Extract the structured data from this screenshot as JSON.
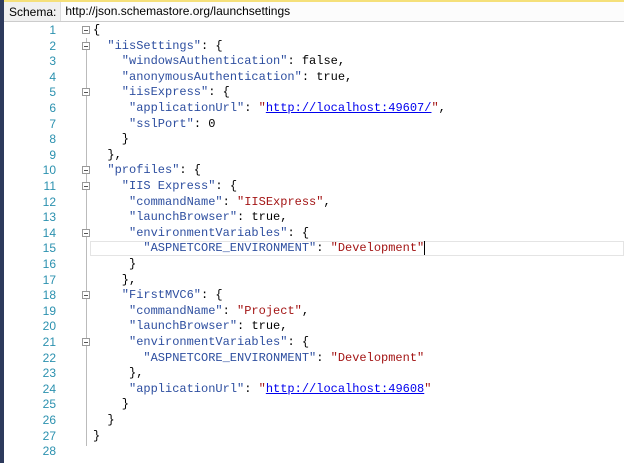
{
  "schema": {
    "label": "Schema:",
    "url": "http://json.schemastore.org/launchsettings"
  },
  "current_line": 15,
  "lines": [
    {
      "n": "1",
      "fold": true,
      "ind": 0,
      "tok": [
        [
          "p",
          "{"
        ]
      ]
    },
    {
      "n": "2",
      "fold": true,
      "ind": 1,
      "tok": [
        [
          "k",
          "\"iisSettings\""
        ],
        [
          "p",
          ": {"
        ]
      ]
    },
    {
      "n": "3",
      "ind": 2,
      "tok": [
        [
          "k",
          "\"windowsAuthentication\""
        ],
        [
          "p",
          ": "
        ],
        [
          "b",
          "false"
        ],
        [
          "p",
          ","
        ]
      ]
    },
    {
      "n": "4",
      "ind": 2,
      "tok": [
        [
          "k",
          "\"anonymousAuthentication\""
        ],
        [
          "p",
          ": "
        ],
        [
          "b",
          "true"
        ],
        [
          "p",
          ","
        ]
      ]
    },
    {
      "n": "5",
      "fold": true,
      "ind": 2,
      "tok": [
        [
          "k",
          "\"iisExpress\""
        ],
        [
          "p",
          ": {"
        ]
      ]
    },
    {
      "n": "6",
      "ind": 3,
      "tok": [
        [
          "k",
          "\"applicationUrl\""
        ],
        [
          "p",
          ": "
        ],
        [
          "s",
          "\""
        ],
        [
          "u",
          "http://localhost:49607/"
        ],
        [
          "s",
          "\""
        ],
        [
          "p",
          ","
        ]
      ]
    },
    {
      "n": "7",
      "ind": 3,
      "tok": [
        [
          "k",
          "\"sslPort\""
        ],
        [
          "p",
          ": 0"
        ]
      ]
    },
    {
      "n": "8",
      "ind": 2,
      "tok": [
        [
          "p",
          "}"
        ]
      ]
    },
    {
      "n": "9",
      "ind": 1,
      "tok": [
        [
          "p",
          "},"
        ]
      ]
    },
    {
      "n": "10",
      "fold": true,
      "ind": 1,
      "tok": [
        [
          "k",
          "\"profiles\""
        ],
        [
          "p",
          ": {"
        ]
      ]
    },
    {
      "n": "11",
      "fold": true,
      "ind": 2,
      "tok": [
        [
          "k",
          "\"IIS Express\""
        ],
        [
          "p",
          ": {"
        ]
      ]
    },
    {
      "n": "12",
      "ind": 3,
      "tok": [
        [
          "k",
          "\"commandName\""
        ],
        [
          "p",
          ": "
        ],
        [
          "s",
          "\"IISExpress\""
        ],
        [
          "p",
          ","
        ]
      ]
    },
    {
      "n": "13",
      "ind": 3,
      "tok": [
        [
          "k",
          "\"launchBrowser\""
        ],
        [
          "p",
          ": "
        ],
        [
          "b",
          "true"
        ],
        [
          "p",
          ","
        ]
      ]
    },
    {
      "n": "14",
      "fold": true,
      "ind": 3,
      "tok": [
        [
          "k",
          "\"environmentVariables\""
        ],
        [
          "p",
          ": {"
        ]
      ]
    },
    {
      "n": "15",
      "ind": 4,
      "tok": [
        [
          "k",
          "\"ASPNETCORE_ENVIRONMENT\""
        ],
        [
          "p",
          ": "
        ],
        [
          "s",
          "\"Development\""
        ]
      ]
    },
    {
      "n": "16",
      "ind": 3,
      "tok": [
        [
          "p",
          "}"
        ]
      ]
    },
    {
      "n": "17",
      "ind": 2,
      "tok": [
        [
          "p",
          "},"
        ]
      ]
    },
    {
      "n": "18",
      "fold": true,
      "ind": 2,
      "tok": [
        [
          "k",
          "\"FirstMVC6\""
        ],
        [
          "p",
          ": {"
        ]
      ]
    },
    {
      "n": "19",
      "ind": 3,
      "tok": [
        [
          "k",
          "\"commandName\""
        ],
        [
          "p",
          ": "
        ],
        [
          "s",
          "\"Project\""
        ],
        [
          "p",
          ","
        ]
      ]
    },
    {
      "n": "20",
      "ind": 3,
      "tok": [
        [
          "k",
          "\"launchBrowser\""
        ],
        [
          "p",
          ": "
        ],
        [
          "b",
          "true"
        ],
        [
          "p",
          ","
        ]
      ]
    },
    {
      "n": "21",
      "fold": true,
      "ind": 3,
      "tok": [
        [
          "k",
          "\"environmentVariables\""
        ],
        [
          "p",
          ": {"
        ]
      ]
    },
    {
      "n": "22",
      "ind": 4,
      "tok": [
        [
          "k",
          "\"ASPNETCORE_ENVIRONMENT\""
        ],
        [
          "p",
          ": "
        ],
        [
          "s",
          "\"Development\""
        ]
      ]
    },
    {
      "n": "23",
      "ind": 3,
      "tok": [
        [
          "p",
          "},"
        ]
      ]
    },
    {
      "n": "24",
      "ind": 3,
      "tok": [
        [
          "k",
          "\"applicationUrl\""
        ],
        [
          "p",
          ": "
        ],
        [
          "s",
          "\""
        ],
        [
          "u",
          "http://localhost:49608"
        ],
        [
          "s",
          "\""
        ]
      ]
    },
    {
      "n": "25",
      "ind": 2,
      "tok": [
        [
          "p",
          "}"
        ]
      ]
    },
    {
      "n": "26",
      "ind": 1,
      "tok": [
        [
          "p",
          "}"
        ]
      ]
    },
    {
      "n": "27",
      "ind": 0,
      "tok": [
        [
          "p",
          "}"
        ]
      ]
    },
    {
      "n": "28",
      "ind": 0,
      "tok": []
    }
  ]
}
